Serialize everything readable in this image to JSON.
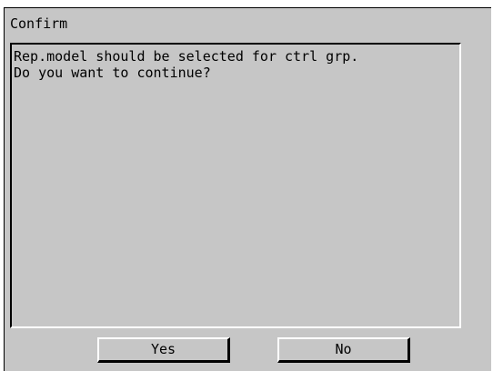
{
  "dialog": {
    "title": "Confirm",
    "message": {
      "line1": "Rep.model should be selected for ctrl grp.",
      "line2": "Do you want to continue?"
    },
    "buttons": {
      "yes_label": "Yes",
      "no_label": "No"
    }
  },
  "colors": {
    "background": "#c6c6c6",
    "text": "#000000",
    "highlight": "#ffffff",
    "shadow": "#000000"
  }
}
